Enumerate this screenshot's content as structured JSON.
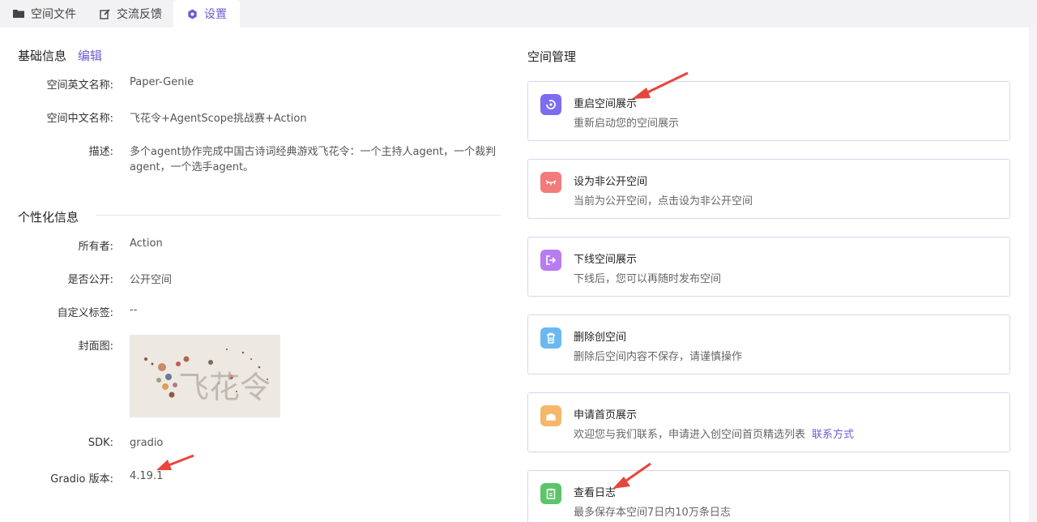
{
  "tabs": [
    {
      "label": "空间文件",
      "icon": "folder-icon"
    },
    {
      "label": "交流反馈",
      "icon": "edit-icon"
    },
    {
      "label": "设置",
      "icon": "gear-icon"
    }
  ],
  "basic": {
    "title": "基础信息",
    "edit": "编辑",
    "fields": [
      {
        "label": "空间英文名称:",
        "value": "Paper-Genie"
      },
      {
        "label": "空间中文名称:",
        "value": "飞花令+AgentScope挑战赛+Action"
      },
      {
        "label": "描述:",
        "value": "多个agent协作完成中国古诗词经典游戏飞花令：一个主持人agent，一个裁判",
        "value2": "agent，一个选手agent。"
      }
    ]
  },
  "personal": {
    "title": "个性化信息",
    "fields": [
      {
        "label": "所有者:",
        "value": "Action"
      },
      {
        "label": "是否公开:",
        "value": "公开空间"
      },
      {
        "label": "自定义标签:",
        "value": "--"
      },
      {
        "label": "封面图:"
      },
      {
        "label": "SDK:",
        "value": "gradio"
      },
      {
        "label": "Gradio 版本:",
        "value": "4.19.1"
      }
    ],
    "cover_text": "飞花令"
  },
  "manage": {
    "title": "空间管理",
    "cards": [
      {
        "title": "重启空间展示",
        "desc": "重新启动您的空间展示",
        "icon": "restart-icon",
        "color": "#7b6cf0"
      },
      {
        "title": "设为非公开空间",
        "desc": "当前为公开空间，点击设为非公开空间",
        "icon": "eye-closed-icon",
        "color": "#f47b7b"
      },
      {
        "title": "下线空间展示",
        "desc": "下线后，您可以再随时发布空间",
        "icon": "logout-icon",
        "color": "#b77cf0"
      },
      {
        "title": "删除创空间",
        "desc": "删除后空间内容不保存，请谨慎操作",
        "icon": "trash-icon",
        "color": "#6cb8f0"
      },
      {
        "title": "申请首页展示",
        "desc": "欢迎您与我们联系，申请进入创空间首页精选列表",
        "link": "联系方式",
        "icon": "home-icon",
        "color": "#f5b86a"
      },
      {
        "title": "查看日志",
        "desc": "最多保存本空间7日内10万条日志",
        "icon": "clipboard-icon",
        "color": "#5cc46a"
      }
    ]
  },
  "colors": {
    "accent": "#6b5cd6",
    "arrow": "#e8453c"
  }
}
